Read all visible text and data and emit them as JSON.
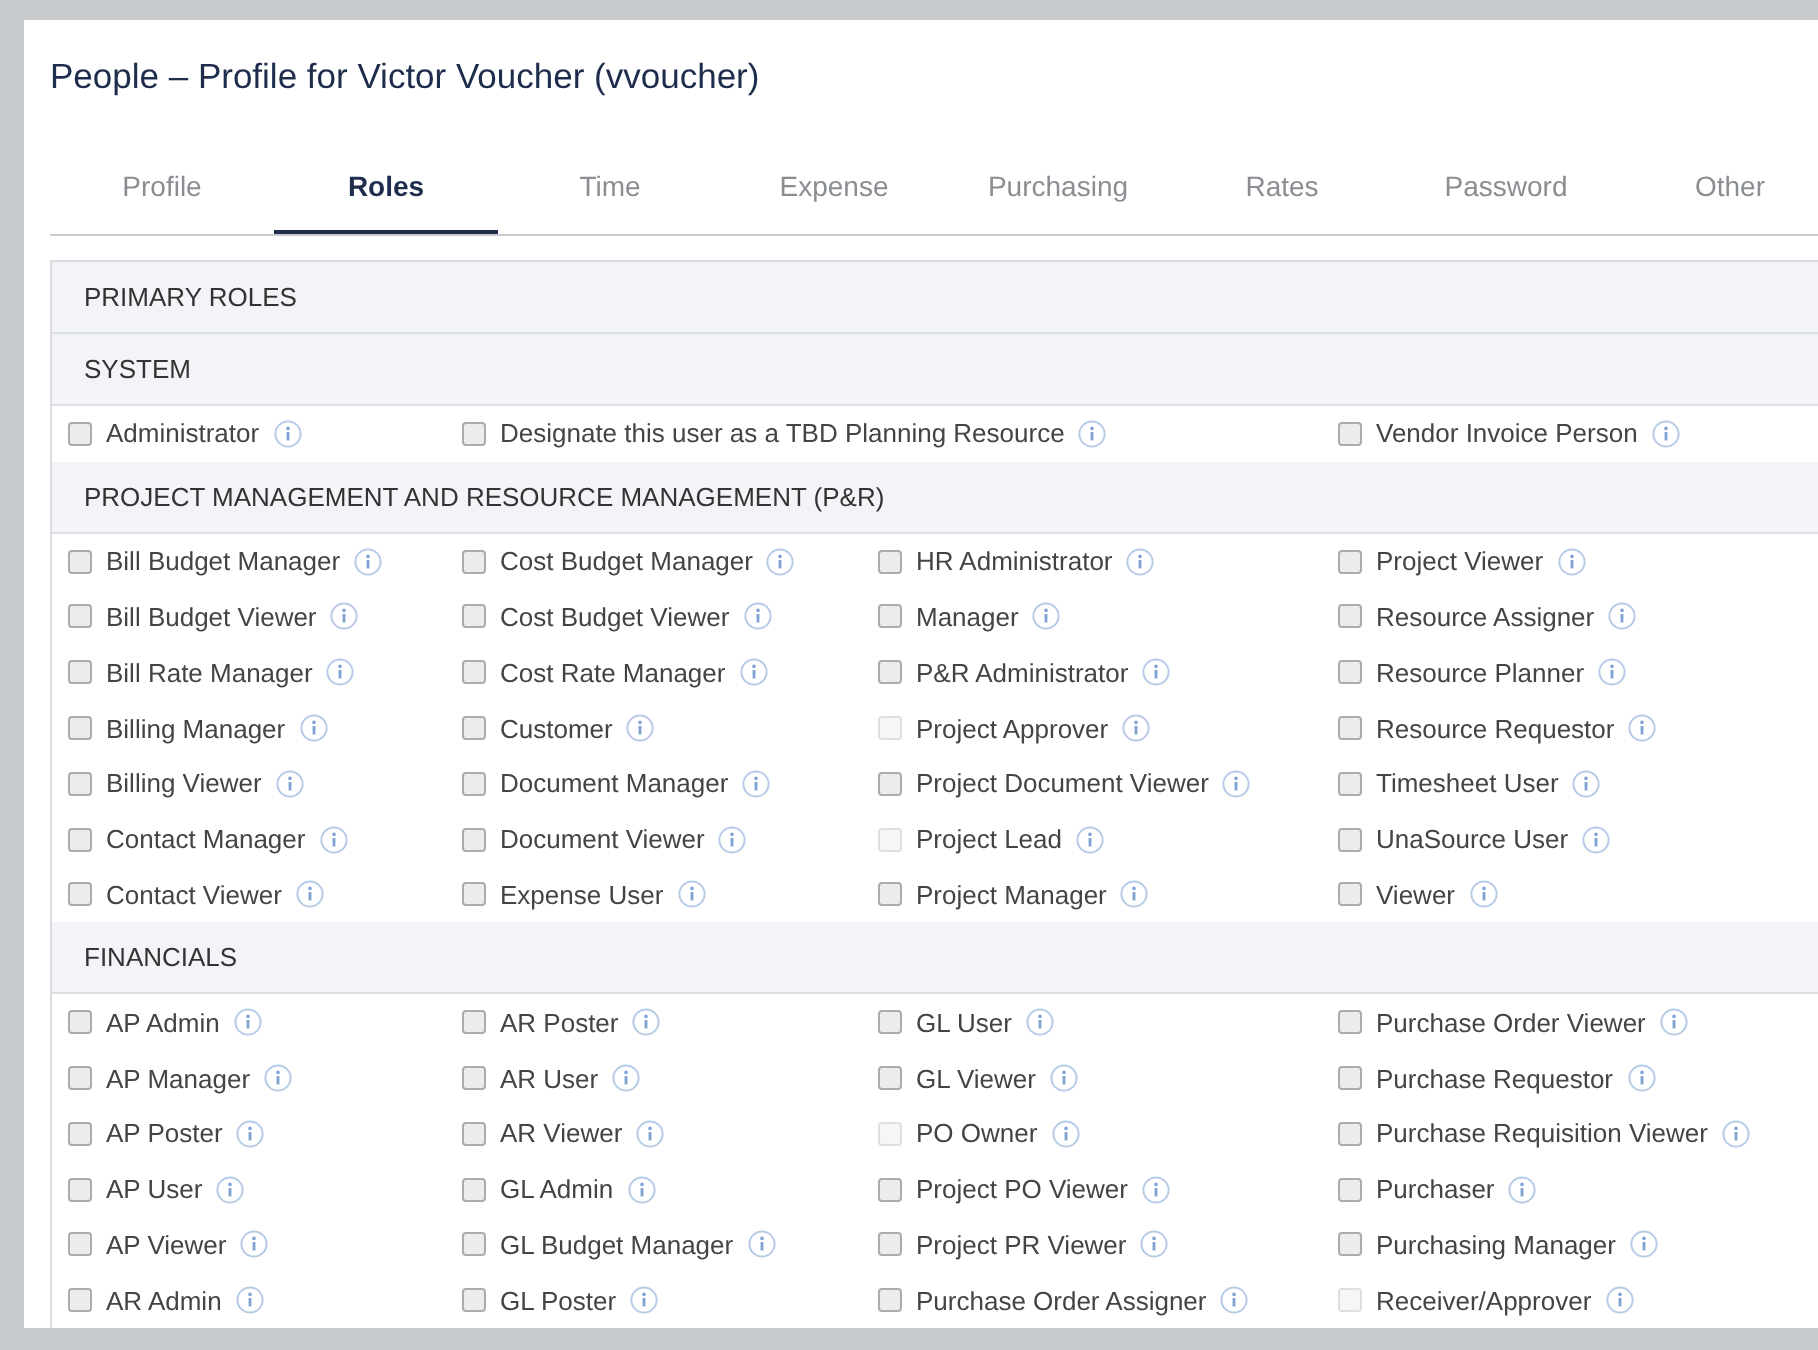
{
  "title": "People – Profile for Victor Voucher (vvoucher)",
  "tabs": [
    {
      "label": "Profile",
      "selected": false
    },
    {
      "label": "Roles",
      "selected": true
    },
    {
      "label": "Time",
      "selected": false
    },
    {
      "label": "Expense",
      "selected": false
    },
    {
      "label": "Purchasing",
      "selected": false
    },
    {
      "label": "Rates",
      "selected": false
    },
    {
      "label": "Password",
      "selected": false
    },
    {
      "label": "Other",
      "selected": false
    }
  ],
  "sections": [
    {
      "title": "PRIMARY ROLES"
    },
    {
      "title": "SYSTEM",
      "roles": [
        {
          "label": "Administrator",
          "checked": false,
          "disabled": false
        },
        {
          "label": "Designate this user as a TBD Planning Resource",
          "checked": false,
          "disabled": false,
          "wide": true
        },
        {
          "label": "Vendor Invoice Person",
          "checked": false,
          "disabled": false
        }
      ]
    },
    {
      "title": "PROJECT MANAGEMENT AND RESOURCE MANAGEMENT (P&R)",
      "roles": [
        {
          "label": "Bill Budget Manager",
          "checked": false,
          "disabled": false
        },
        {
          "label": "Cost Budget Manager",
          "checked": false,
          "disabled": false
        },
        {
          "label": "HR Administrator",
          "checked": false,
          "disabled": false
        },
        {
          "label": "Project Viewer",
          "checked": false,
          "disabled": false
        },
        {
          "label": "Bill Budget Viewer",
          "checked": false,
          "disabled": false
        },
        {
          "label": "Cost Budget Viewer",
          "checked": false,
          "disabled": false
        },
        {
          "label": "Manager",
          "checked": false,
          "disabled": false
        },
        {
          "label": "Resource Assigner",
          "checked": false,
          "disabled": false
        },
        {
          "label": "Bill Rate Manager",
          "checked": false,
          "disabled": false
        },
        {
          "label": "Cost Rate Manager",
          "checked": false,
          "disabled": false
        },
        {
          "label": "P&R Administrator",
          "checked": false,
          "disabled": false
        },
        {
          "label": "Resource Planner",
          "checked": false,
          "disabled": false
        },
        {
          "label": "Billing Manager",
          "checked": false,
          "disabled": false
        },
        {
          "label": "Customer",
          "checked": false,
          "disabled": false
        },
        {
          "label": "Project Approver",
          "checked": false,
          "disabled": true
        },
        {
          "label": "Resource Requestor",
          "checked": false,
          "disabled": false
        },
        {
          "label": "Billing Viewer",
          "checked": false,
          "disabled": false
        },
        {
          "label": "Document Manager",
          "checked": false,
          "disabled": false
        },
        {
          "label": "Project Document Viewer",
          "checked": false,
          "disabled": false
        },
        {
          "label": "Timesheet User",
          "checked": false,
          "disabled": false
        },
        {
          "label": "Contact Manager",
          "checked": false,
          "disabled": false
        },
        {
          "label": "Document Viewer",
          "checked": false,
          "disabled": false
        },
        {
          "label": "Project Lead",
          "checked": false,
          "disabled": true
        },
        {
          "label": "UnaSource User",
          "checked": false,
          "disabled": false
        },
        {
          "label": "Contact Viewer",
          "checked": false,
          "disabled": false
        },
        {
          "label": "Expense User",
          "checked": false,
          "disabled": false
        },
        {
          "label": "Project Manager",
          "checked": false,
          "disabled": false
        },
        {
          "label": "Viewer",
          "checked": false,
          "disabled": false
        }
      ]
    },
    {
      "title": "FINANCIALS",
      "roles": [
        {
          "label": "AP Admin",
          "checked": false,
          "disabled": false
        },
        {
          "label": "AR Poster",
          "checked": false,
          "disabled": false
        },
        {
          "label": "GL User",
          "checked": false,
          "disabled": false
        },
        {
          "label": "Purchase Order Viewer",
          "checked": false,
          "disabled": false
        },
        {
          "label": "AP Manager",
          "checked": false,
          "disabled": false
        },
        {
          "label": "AR User",
          "checked": false,
          "disabled": false
        },
        {
          "label": "GL Viewer",
          "checked": false,
          "disabled": false
        },
        {
          "label": "Purchase Requestor",
          "checked": false,
          "disabled": false
        },
        {
          "label": "AP Poster",
          "checked": false,
          "disabled": false
        },
        {
          "label": "AR Viewer",
          "checked": false,
          "disabled": false
        },
        {
          "label": "PO Owner",
          "checked": false,
          "disabled": true
        },
        {
          "label": "Purchase Requisition Viewer",
          "checked": false,
          "disabled": false
        },
        {
          "label": "AP User",
          "checked": false,
          "disabled": false
        },
        {
          "label": "GL Admin",
          "checked": false,
          "disabled": false
        },
        {
          "label": "Project PO Viewer",
          "checked": false,
          "disabled": false
        },
        {
          "label": "Purchaser",
          "checked": false,
          "disabled": false
        },
        {
          "label": "AP Viewer",
          "checked": false,
          "disabled": false
        },
        {
          "label": "GL Budget Manager",
          "checked": false,
          "disabled": false
        },
        {
          "label": "Project PR Viewer",
          "checked": false,
          "disabled": false
        },
        {
          "label": "Purchasing Manager",
          "checked": false,
          "disabled": false
        },
        {
          "label": "AR Admin",
          "checked": false,
          "disabled": false
        },
        {
          "label": "GL Poster",
          "checked": false,
          "disabled": false
        },
        {
          "label": "Purchase Order Assigner",
          "checked": false,
          "disabled": false
        },
        {
          "label": "Receiver/Approver",
          "checked": false,
          "disabled": true
        }
      ]
    }
  ]
}
